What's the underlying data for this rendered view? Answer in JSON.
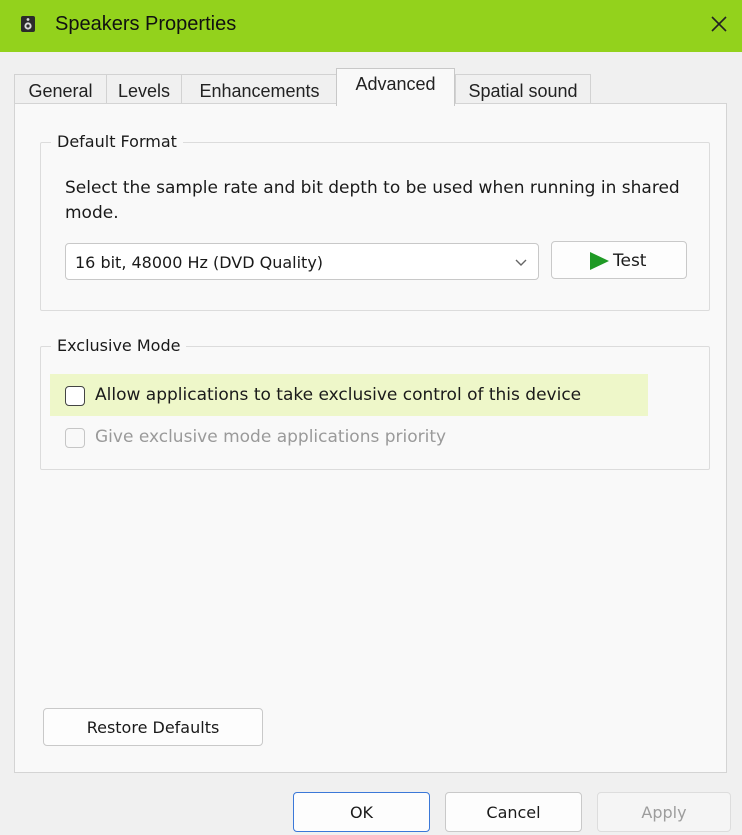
{
  "window": {
    "title": "Speakers Properties",
    "title_icon": "speaker-icon",
    "accent_color": "#93d21c"
  },
  "tabs": [
    {
      "label": "General",
      "active": false
    },
    {
      "label": "Levels",
      "active": false
    },
    {
      "label": "Enhancements",
      "active": false
    },
    {
      "label": "Advanced",
      "active": true
    },
    {
      "label": "Spatial sound",
      "active": false
    }
  ],
  "default_format": {
    "group_label": "Default Format",
    "description": "Select the sample rate and bit depth to be used when running in shared mode.",
    "selected_format": "16 bit, 48000 Hz (DVD Quality)",
    "test_label": "Test",
    "test_icon": "play-icon"
  },
  "exclusive_mode": {
    "group_label": "Exclusive Mode",
    "allow_exclusive_label": "Allow applications to take exclusive control of this device",
    "allow_exclusive_checked": false,
    "priority_label": "Give exclusive mode applications priority",
    "priority_checked": false,
    "priority_enabled": false,
    "highlight_color": "#eef7c9"
  },
  "restore_defaults_label": "Restore Defaults",
  "footer": {
    "ok_label": "OK",
    "cancel_label": "Cancel",
    "apply_label": "Apply",
    "apply_enabled": false
  }
}
